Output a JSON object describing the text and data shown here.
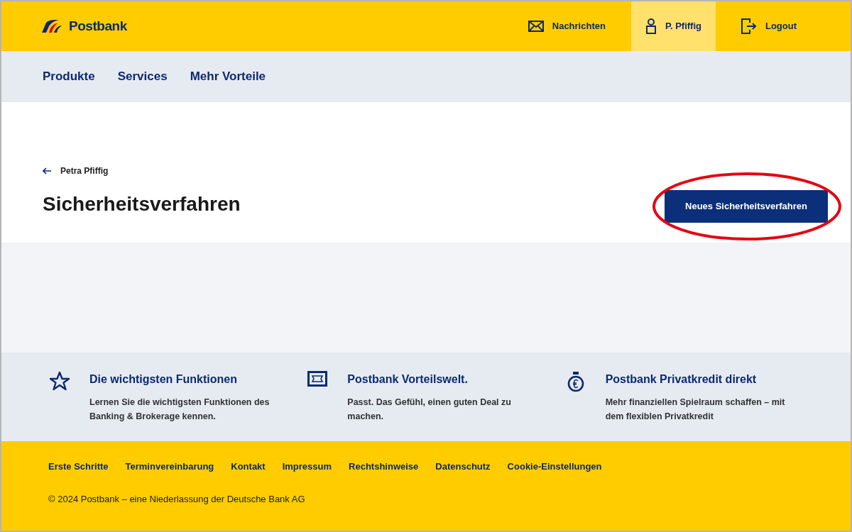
{
  "header": {
    "logo": "Postbank",
    "items": [
      {
        "kind": "mail",
        "label": "Nachrichten",
        "selected": false
      },
      {
        "kind": "user",
        "label": "P. Pfiffig",
        "selected": true
      },
      {
        "kind": "logout",
        "label": "Logout",
        "selected": false
      }
    ]
  },
  "nav": [
    "Produkte",
    "Services",
    "Mehr Vorteile"
  ],
  "page": {
    "back_link": "Petra Pfiffig",
    "title": "Sicherheitsverfahren",
    "action_button": {
      "label": "Neues Sicherheitsverfahren",
      "circled": true
    }
  },
  "promos": [
    {
      "kind": "star",
      "title": "Die wichtigsten Funktionen",
      "text": "Lernen Sie die wichtigsten Funktionen des Banking & Brokerage kennen."
    },
    {
      "kind": "ticket",
      "title": "Postbank Vorteilswelt.",
      "text": "Passt. Das Gefühl, einen guten Deal zu machen."
    },
    {
      "kind": "euro",
      "title": "Postbank Privatkredit direkt",
      "text": "Mehr finanziellen Spielraum schaffen – mit dem flexiblen Privatkredit"
    }
  ],
  "footer": {
    "links": [
      "Erste Schritte",
      "Terminvereinbarung",
      "Kontakt",
      "Impressum",
      "Rechtshinweise",
      "Datenschutz",
      "Cookie-Einstellungen"
    ],
    "copyright": "© 2024 Postbank – eine Niederlassung der Deutsche Bank AG"
  }
}
